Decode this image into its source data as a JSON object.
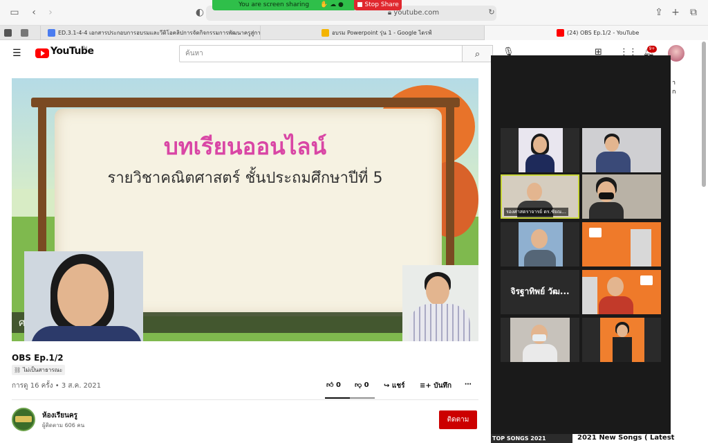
{
  "browser": {
    "address": "youtube.com",
    "screen_share_banner": "You are screen sharing",
    "stop_share_label": "Stop Share",
    "tabs": [
      {
        "label": "ED.3.1-4-4 เอกสารประกอบการอบรมและวีดิโอคลิปการจัดกิจกรรมการพัฒนาครูสู่การจัดการเรี...",
        "icon": "docs-icon",
        "color": "#4a7cf0"
      },
      {
        "label": "อบรม Powerpoint รุ่น 1 - Google ไดรฟ์",
        "icon": "drive-icon",
        "color": "#f4b400"
      },
      {
        "label": "(24) OBS Ep.1/2 - YouTube",
        "icon": "youtube-icon",
        "color": "#ff0000"
      }
    ]
  },
  "youtube": {
    "logo_text": "YouTube",
    "region": "TH",
    "search_placeholder": "ค้นหา",
    "notification_count": "9+"
  },
  "video": {
    "slide_title": "บทเรียนออนไลน์",
    "slide_subtitle": "รายวิชาคณิตศาสตร์ ชั้นประถมศึกษาปีที่ 5",
    "lower_banner": "ศาสต์...ษาปีที่ 5"
  },
  "meta": {
    "title": "OBS Ep.1/2",
    "visibility": "ไม่เป็นสาธารณะ",
    "views": "การดู 16 ครั้ง • 3 ส.ค. 2021",
    "likes": "0",
    "dislikes": "0",
    "share_label": "แชร์",
    "save_label": "บันทึก",
    "more_label": "⋯"
  },
  "channel": {
    "name": "ห้องเรียนครู",
    "subscribers": "ผู้ติดตาม 606 คน",
    "subscribe_label": "ติดตาม"
  },
  "sidebar": {
    "peek1": "า",
    "peek2": "ก",
    "rec_thumb_text": "TOP SONGS 2021",
    "rec_title": "2021 New Songs ( Latest"
  },
  "zoom": {
    "tiles": [
      {
        "name": "",
        "bg": "#e9e6ef",
        "active": false
      },
      {
        "name": "",
        "bg": "#cfcfd2",
        "active": false
      },
      {
        "name": "รองศาสตราจารย์ ดร.ชัยณ...",
        "bg": "#d5cdbf",
        "active": true
      },
      {
        "name": "",
        "bg": "#b9b2a6",
        "active": false
      },
      {
        "name": "",
        "bg": "#8fb0d0",
        "active": false
      },
      {
        "name": "",
        "bg": "#ef7a2a",
        "active": false
      },
      {
        "name": "จิรฐาทิพย์ วัฒ...",
        "bg": "#2a2a2a",
        "active": false,
        "text_only": true
      },
      {
        "name": "",
        "bg": "#ef7a2a",
        "active": false
      },
      {
        "name": "",
        "bg": "#c7c2bb",
        "active": false
      },
      {
        "name": "",
        "bg": "#f07f2e",
        "active": false
      }
    ]
  }
}
